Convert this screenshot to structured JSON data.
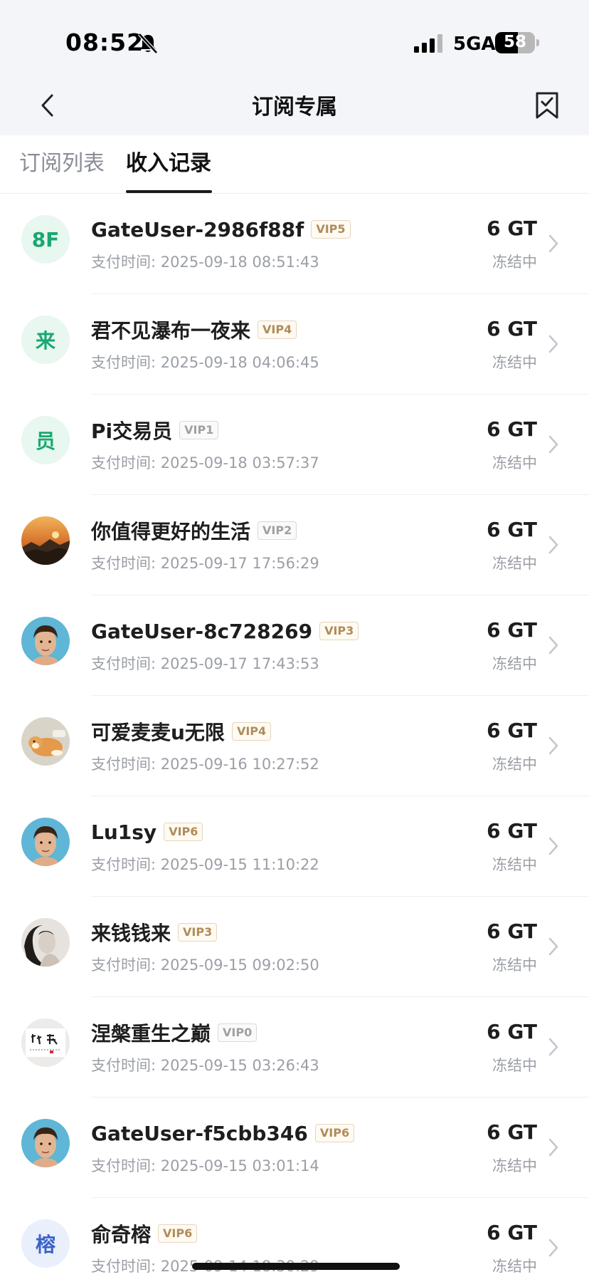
{
  "status_bar": {
    "time": "08:52",
    "network": "5GA",
    "battery": "58",
    "battery_fraction": 0.58
  },
  "header": {
    "title": "订阅专属",
    "back_icon": "chevron-left-icon",
    "bookmark_icon": "bookmark-icon"
  },
  "tabs": [
    {
      "label": "订阅列表",
      "active": false
    },
    {
      "label": "收入记录",
      "active": true
    }
  ],
  "records": [
    {
      "avatar_type": "text",
      "avatar_text": "8F",
      "avatar_bg": "green",
      "name": "GateUser-2986f88f",
      "vip": "VIP5",
      "vip_style": "gold",
      "time": "支付时间: 2025-09-18 08:51:43",
      "amount": "6 GT",
      "state": "冻结中"
    },
    {
      "avatar_type": "text",
      "avatar_text": "来",
      "avatar_bg": "green",
      "name": "君不见瀑布一夜来",
      "vip": "VIP4",
      "vip_style": "gold",
      "time": "支付时间: 2025-09-18 04:06:45",
      "amount": "6 GT",
      "state": "冻结中"
    },
    {
      "avatar_type": "text",
      "avatar_text": "员",
      "avatar_bg": "green",
      "name": "Pi交易员",
      "vip": "VIP1",
      "vip_style": "gray",
      "time": "支付时间: 2025-09-18 03:57:37",
      "amount": "6 GT",
      "state": "冻结中"
    },
    {
      "avatar_type": "image",
      "avatar_image": "landscape-avatar",
      "name": "你值得更好的生活",
      "vip": "VIP2",
      "vip_style": "gray",
      "time": "支付时间: 2025-09-17 17:56:29",
      "amount": "6 GT",
      "state": "冻结中"
    },
    {
      "avatar_type": "image",
      "avatar_image": "face-avatar",
      "name": "GateUser-8c728269",
      "vip": "VIP3",
      "vip_style": "gold",
      "time": "支付时间: 2025-09-17 17:43:53",
      "amount": "6 GT",
      "state": "冻结中"
    },
    {
      "avatar_type": "image",
      "avatar_image": "dog-avatar",
      "name": "可爱麦麦u无限",
      "vip": "VIP4",
      "vip_style": "gold",
      "time": "支付时间: 2025-09-16 10:27:52",
      "amount": "6 GT",
      "state": "冻结中"
    },
    {
      "avatar_type": "image",
      "avatar_image": "face-avatar",
      "name": "Lu1sy",
      "vip": "VIP6",
      "vip_style": "gold",
      "time": "支付时间: 2025-09-15 11:10:22",
      "amount": "6 GT",
      "state": "冻结中"
    },
    {
      "avatar_type": "image",
      "avatar_image": "portrait-avatar",
      "name": "来钱钱来",
      "vip": "VIP3",
      "vip_style": "gold",
      "time": "支付时间: 2025-09-15 09:02:50",
      "amount": "6 GT",
      "state": "冻结中"
    },
    {
      "avatar_type": "image",
      "avatar_image": "calligraphy-avatar",
      "name": "涅槃重生之巅",
      "vip": "VIP0",
      "vip_style": "gray",
      "time": "支付时间: 2025-09-15 03:26:43",
      "amount": "6 GT",
      "state": "冻结中"
    },
    {
      "avatar_type": "image",
      "avatar_image": "face-avatar",
      "name": "GateUser-f5cbb346",
      "vip": "VIP6",
      "vip_style": "gold",
      "time": "支付时间: 2025-09-15 03:01:14",
      "amount": "6 GT",
      "state": "冻结中"
    },
    {
      "avatar_type": "text",
      "avatar_text": "榕",
      "avatar_bg": "blue",
      "name": "俞奇榕",
      "vip": "VIP6",
      "vip_style": "gold",
      "time": "支付时间: 2025-09-14 18:30:29",
      "amount": "6 GT",
      "state": "冻结中"
    }
  ],
  "colors": {
    "header_bg": "#f4f5f9",
    "text_primary": "#1e1e1e",
    "text_secondary": "#9b9ea6",
    "avatar_green": "#19a871",
    "vip_gold": "#b08c5a"
  }
}
